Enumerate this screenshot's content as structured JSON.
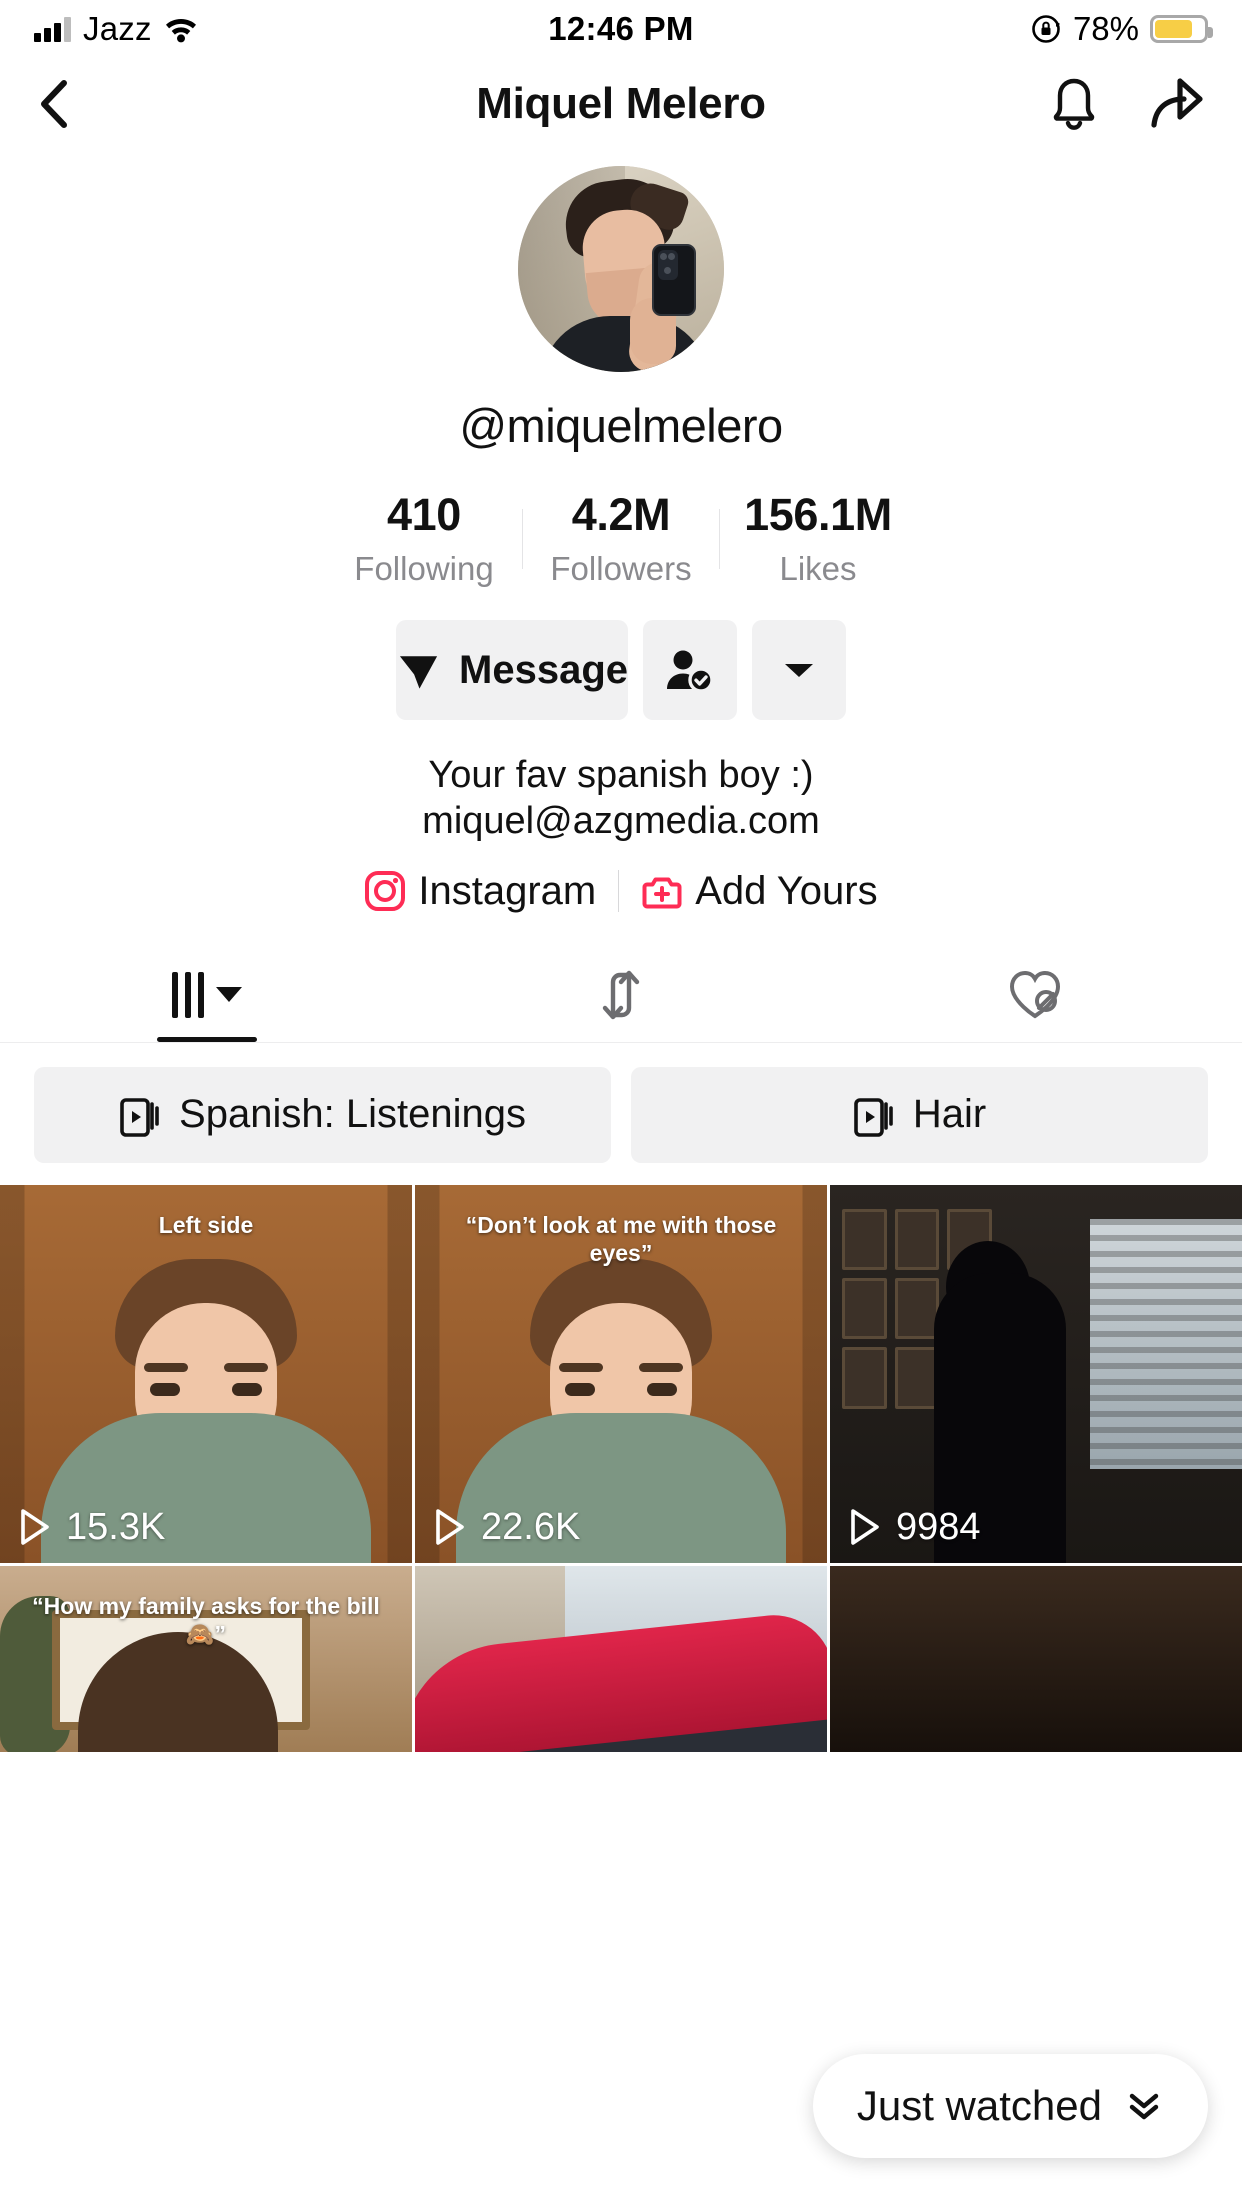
{
  "status_bar": {
    "carrier": "Jazz",
    "time": "12:46 PM",
    "battery_pct": "78%",
    "battery_level": 78,
    "battery_color": "#F7CE46",
    "icons": [
      "signal-bars-icon",
      "wifi-icon",
      "rotation-lock-icon",
      "battery-icon"
    ]
  },
  "header": {
    "title": "Miquel Melero",
    "back_icon": "chevron-left-icon",
    "bell_icon": "bell-icon",
    "share_icon": "share-arrow-icon"
  },
  "profile": {
    "handle": "@miquelmelero",
    "avatar_alt": "profile-avatar",
    "stats": [
      {
        "value": "410",
        "label": "Following"
      },
      {
        "value": "4.2M",
        "label": "Followers"
      },
      {
        "value": "156.1M",
        "label": "Likes"
      }
    ],
    "actions": {
      "message_label": "Message",
      "message_icon": "paper-plane-icon",
      "follow_icon": "person-check-icon",
      "more_icon": "chevron-down-icon"
    },
    "bio": [
      "Your fav spanish boy :)",
      "miquel@azgmedia.com"
    ],
    "links": [
      {
        "label": "Instagram",
        "icon": "instagram-icon",
        "color": "#FE2C55"
      },
      {
        "label": "Add Yours",
        "icon": "add-yours-icon",
        "color": "#FE2C55"
      }
    ]
  },
  "tabs": [
    {
      "name": "videos",
      "icon": "grid-icon",
      "active": true,
      "has_caret": true
    },
    {
      "name": "reposts",
      "icon": "repost-arrows-icon",
      "active": false,
      "has_caret": false
    },
    {
      "name": "liked",
      "icon": "heart-hidden-icon",
      "active": false,
      "has_caret": false
    }
  ],
  "playlists": [
    {
      "label": "Spanish: Listenings",
      "icon": "playlist-icon"
    },
    {
      "label": "Hair",
      "icon": "playlist-icon"
    }
  ],
  "videos": [
    {
      "views": "15.3K",
      "caption": "Left side",
      "play_icon": "play-icon"
    },
    {
      "views": "22.6K",
      "caption": "“Don’t look at me with those eyes”",
      "play_icon": "play-icon"
    },
    {
      "views": "9984",
      "caption": "",
      "play_icon": "play-icon"
    },
    {
      "views": "",
      "caption": "“How my family asks for the bill 🙈”",
      "play_icon": "play-icon"
    },
    {
      "views": "",
      "caption": "",
      "play_icon": "play-icon"
    },
    {
      "views": "",
      "caption": "",
      "play_icon": "play-icon"
    }
  ],
  "just_watched": {
    "label": "Just watched",
    "icon": "double-chevron-down-icon"
  },
  "colors": {
    "accent": "#FE2C55",
    "button_bg": "#F1F1F2",
    "text": "#111111",
    "muted": "#8A8A8E"
  }
}
